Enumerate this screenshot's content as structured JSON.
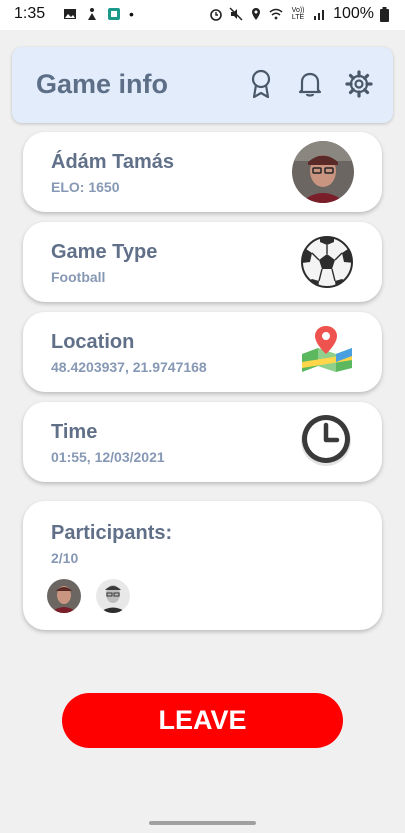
{
  "status_bar": {
    "time": "1:35",
    "dot": "•",
    "network": "Vo)) LTE",
    "battery": "100%"
  },
  "header": {
    "title": "Game info"
  },
  "player": {
    "name": "Ádám Tamás",
    "elo": "ELO: 1650"
  },
  "game_type": {
    "title": "Game Type",
    "value": "Football"
  },
  "location": {
    "title": "Location",
    "value": "48.4203937, 21.9747168"
  },
  "time": {
    "title": "Time",
    "value": "01:55, 12/03/2021"
  },
  "participants": {
    "title": "Participants:",
    "count": "2/10"
  },
  "actions": {
    "leave_label": "LEAVE"
  },
  "colors": {
    "accent_blue": "#5d6f87",
    "header_bg": "#e2ecfb",
    "leave_red": "#ff0000"
  }
}
